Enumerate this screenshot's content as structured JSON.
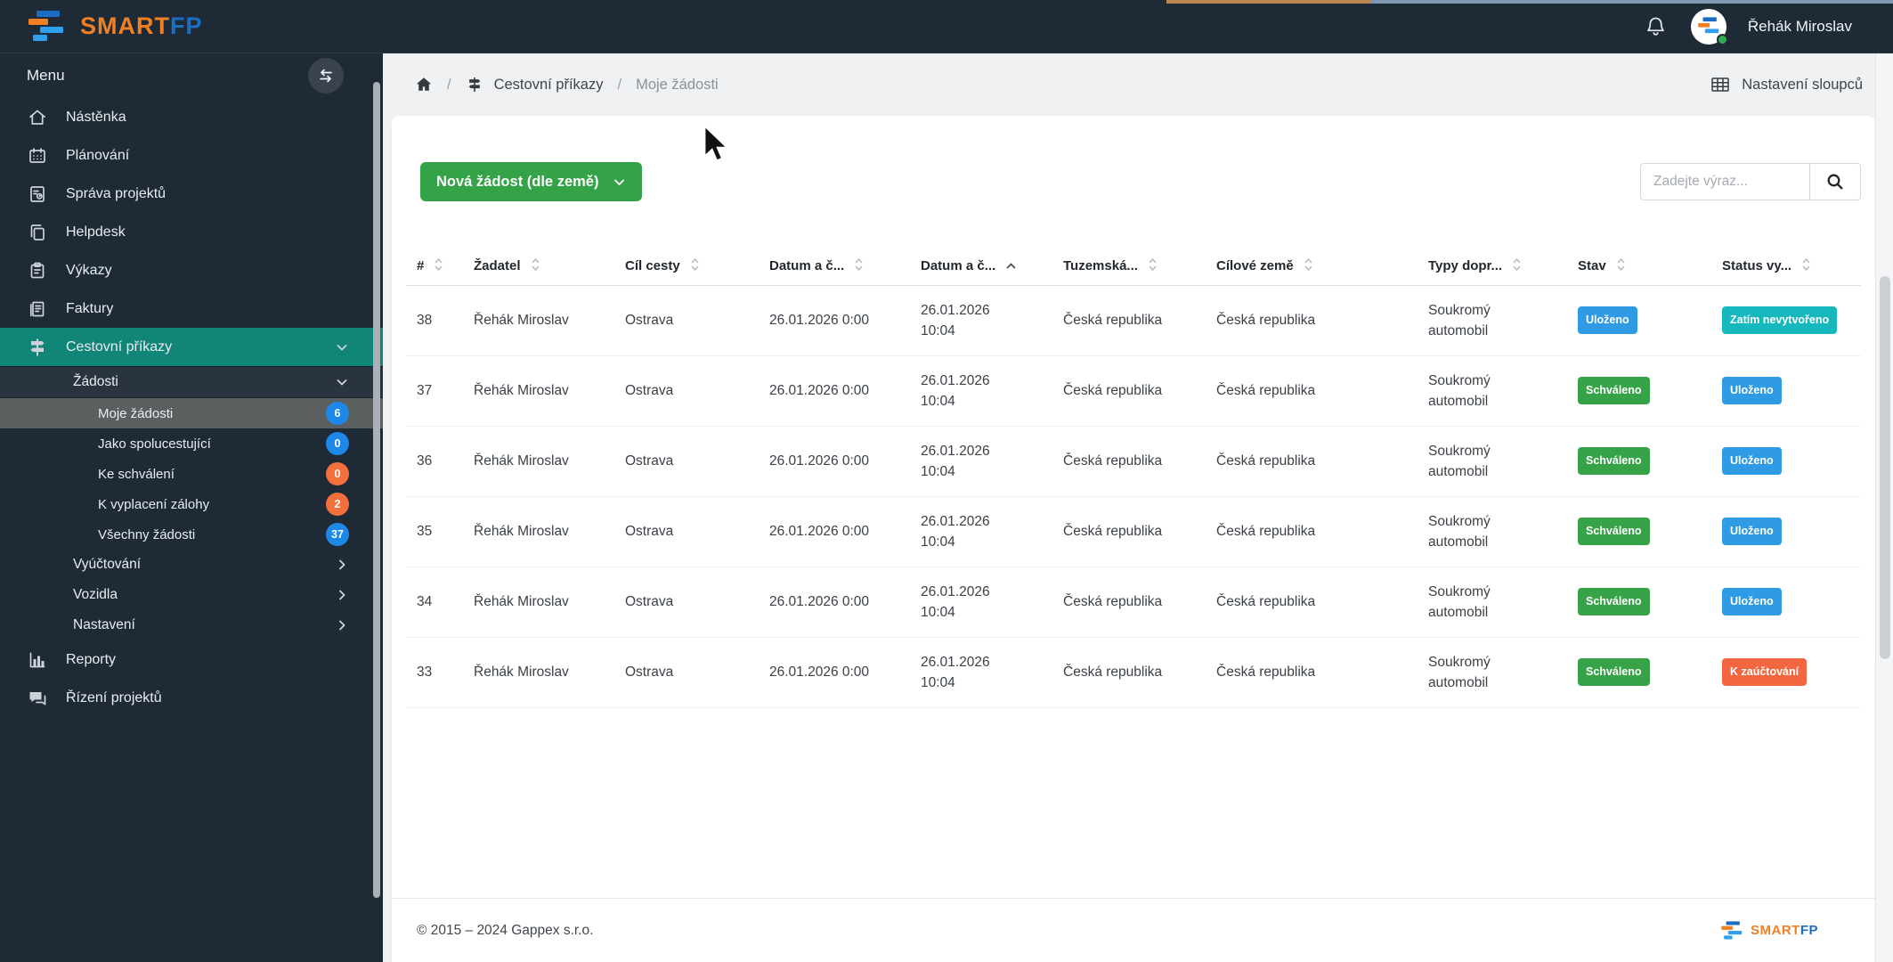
{
  "brand": {
    "name_primary": "SMART",
    "name_secondary": "FP"
  },
  "header": {
    "user_name": "Řehák Miroslav"
  },
  "sidebar": {
    "menu_label": "Menu",
    "items": [
      {
        "icon": "home",
        "label": "Nástěnka",
        "type": "top"
      },
      {
        "icon": "calendar",
        "label": "Plánování",
        "type": "top"
      },
      {
        "icon": "projects",
        "label": "Správa projektů",
        "type": "top"
      },
      {
        "icon": "helpdesk",
        "label": "Helpdesk",
        "type": "top"
      },
      {
        "icon": "clipboard",
        "label": "Výkazy",
        "type": "top"
      },
      {
        "icon": "invoice",
        "label": "Faktury",
        "type": "top"
      },
      {
        "icon": "signpost",
        "label": "Cestovní příkazy",
        "type": "top",
        "active": true,
        "chevron": "down"
      },
      {
        "label": "Žádosti",
        "type": "sub",
        "chevron": "down"
      },
      {
        "label": "Moje žádosti",
        "type": "subsub",
        "active": true,
        "badge": {
          "value": "6",
          "color": "blue"
        }
      },
      {
        "label": "Jako spolucestující",
        "type": "subsub",
        "badge": {
          "value": "0",
          "color": "blue"
        }
      },
      {
        "label": "Ke schválení",
        "type": "subsub",
        "badge": {
          "value": "0",
          "color": "orange"
        }
      },
      {
        "label": "K vyplacení zálohy",
        "type": "subsub",
        "badge": {
          "value": "2",
          "color": "orange"
        }
      },
      {
        "label": "Všechny žádosti",
        "type": "subsub",
        "badge": {
          "value": "37",
          "color": "blue"
        }
      },
      {
        "label": "Vyúčtování",
        "type": "sub2",
        "chevron": "right"
      },
      {
        "label": "Vozidla",
        "type": "sub2",
        "chevron": "right"
      },
      {
        "label": "Nastavení",
        "type": "sub2",
        "chevron": "right"
      },
      {
        "icon": "chart",
        "label": "Reporty",
        "type": "top"
      },
      {
        "icon": "chat",
        "label": "Řízení projektů",
        "type": "top"
      }
    ]
  },
  "breadcrumb": {
    "section": "Cestovní příkazy",
    "page": "Moje žádosti"
  },
  "columns_settings": {
    "label": "Nastavení sloupců"
  },
  "toolbar": {
    "new_button": "Nová žádost (dle země)",
    "search_placeholder": "Zadejte výraz..."
  },
  "table": {
    "columns": [
      {
        "label": "#",
        "sort": "both"
      },
      {
        "label": "Žadatel",
        "sort": "both"
      },
      {
        "label": "Cíl cesty",
        "sort": "both"
      },
      {
        "label": "Datum a č...",
        "sort": "both"
      },
      {
        "label": "Datum a č...",
        "sort": "asc"
      },
      {
        "label": "Tuzemská...",
        "sort": "both"
      },
      {
        "label": "Cílové země",
        "sort": "both"
      },
      {
        "label": "Typy dopr...",
        "sort": "both"
      },
      {
        "label": "Stav",
        "sort": "both"
      },
      {
        "label": "Status vy...",
        "sort": "both"
      }
    ],
    "rows": [
      {
        "id": "38",
        "applicant": "Řehák Miroslav",
        "destination": "Ostrava",
        "datetime_from": "26.01.2026 0:00",
        "datetime_to": "26.01.2026 10:04",
        "domestic": "Česká republika",
        "target_country": "Česká republika",
        "transport": "Soukromý automobil",
        "state": {
          "label": "Uloženo",
          "color": "blue"
        },
        "status": {
          "label": "Zatím nevytvořeno",
          "color": "teal"
        }
      },
      {
        "id": "37",
        "applicant": "Řehák Miroslav",
        "destination": "Ostrava",
        "datetime_from": "26.01.2026 0:00",
        "datetime_to": "26.01.2026 10:04",
        "domestic": "Česká republika",
        "target_country": "Česká republika",
        "transport": "Soukromý automobil",
        "state": {
          "label": "Schváleno",
          "color": "green"
        },
        "status": {
          "label": "Uloženo",
          "color": "blue"
        }
      },
      {
        "id": "36",
        "applicant": "Řehák Miroslav",
        "destination": "Ostrava",
        "datetime_from": "26.01.2026 0:00",
        "datetime_to": "26.01.2026 10:04",
        "domestic": "Česká republika",
        "target_country": "Česká republika",
        "transport": "Soukromý automobil",
        "state": {
          "label": "Schváleno",
          "color": "green"
        },
        "status": {
          "label": "Uloženo",
          "color": "blue"
        }
      },
      {
        "id": "35",
        "applicant": "Řehák Miroslav",
        "destination": "Ostrava",
        "datetime_from": "26.01.2026 0:00",
        "datetime_to": "26.01.2026 10:04",
        "domestic": "Česká republika",
        "target_country": "Česká republika",
        "transport": "Soukromý automobil",
        "state": {
          "label": "Schváleno",
          "color": "green"
        },
        "status": {
          "label": "Uloženo",
          "color": "blue"
        }
      },
      {
        "id": "34",
        "applicant": "Řehák Miroslav",
        "destination": "Ostrava",
        "datetime_from": "26.01.2026 0:00",
        "datetime_to": "26.01.2026 10:04",
        "domestic": "Česká republika",
        "target_country": "Česká republika",
        "transport": "Soukromý automobil",
        "state": {
          "label": "Schváleno",
          "color": "green"
        },
        "status": {
          "label": "Uloženo",
          "color": "blue"
        }
      },
      {
        "id": "33",
        "applicant": "Řehák Miroslav",
        "destination": "Ostrava",
        "datetime_from": "26.01.2026 0:00",
        "datetime_to": "26.01.2026 10:04",
        "domestic": "Česká republika",
        "target_country": "Česká republika",
        "transport": "Soukromý automobil",
        "state": {
          "label": "Schváleno",
          "color": "green"
        },
        "status": {
          "label": "K zaúčtování",
          "color": "orange"
        }
      }
    ]
  },
  "footer": {
    "copyright": "© 2015 – 2024 Gappex s.r.o."
  },
  "colors": {
    "button_green": "#34a348",
    "menu_active_teal": "#108578",
    "badge_blue": "#2e9be4",
    "badge_teal": "#16b8bd",
    "badge_green": "#37a348",
    "badge_orange": "#f26740",
    "sidebar_badge_blue": "#1e88e8",
    "sidebar_badge_orange": "#f3703d"
  }
}
